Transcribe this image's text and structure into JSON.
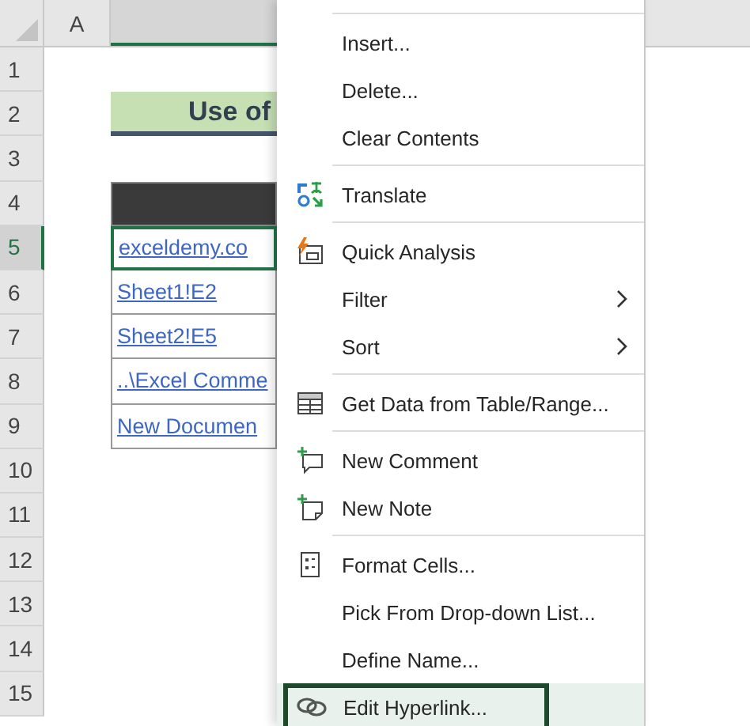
{
  "sheet": {
    "columns": [
      {
        "label": "A",
        "selected": false
      },
      {
        "selected": true
      }
    ],
    "rows": [
      {
        "number": "1",
        "selected": false,
        "kind": "blank"
      },
      {
        "number": "2",
        "selected": false,
        "kind": "title",
        "text": "Use of"
      },
      {
        "number": "3",
        "selected": false,
        "kind": "blank"
      },
      {
        "number": "4",
        "selected": false,
        "kind": "table_header"
      },
      {
        "number": "5",
        "selected": true,
        "kind": "link",
        "text": "exceldemy.co"
      },
      {
        "number": "6",
        "selected": false,
        "kind": "link",
        "text": "Sheet1!E2"
      },
      {
        "number": "7",
        "selected": false,
        "kind": "link",
        "text": "Sheet2!E5"
      },
      {
        "number": "8",
        "selected": false,
        "kind": "link",
        "text": "..\\Excel Comme"
      },
      {
        "number": "9",
        "selected": false,
        "kind": "link",
        "text": "New Documen"
      },
      {
        "number": "10",
        "selected": false,
        "kind": "blank"
      },
      {
        "number": "11",
        "selected": false,
        "kind": "blank"
      },
      {
        "number": "12",
        "selected": false,
        "kind": "blank"
      },
      {
        "number": "13",
        "selected": false,
        "kind": "blank"
      },
      {
        "number": "14",
        "selected": false,
        "kind": "blank"
      },
      {
        "number": "15",
        "selected": false,
        "kind": "blank"
      }
    ]
  },
  "context_menu": {
    "items": [
      {
        "kind": "separator"
      },
      {
        "kind": "item",
        "label": "Insert...",
        "submenu": false,
        "selected": false
      },
      {
        "kind": "item",
        "label": "Delete...",
        "submenu": false,
        "selected": false
      },
      {
        "kind": "item",
        "label": "Clear Contents",
        "submenu": false,
        "selected": false
      },
      {
        "kind": "separator"
      },
      {
        "kind": "translate",
        "label": "Translate",
        "submenu": false,
        "selected": false
      },
      {
        "kind": "separator"
      },
      {
        "kind": "analysis",
        "label": "Quick Analysis",
        "submenu": false,
        "selected": false
      },
      {
        "kind": "item",
        "label": "Filter",
        "submenu": true,
        "selected": false
      },
      {
        "kind": "item",
        "label": "Sort",
        "submenu": true,
        "selected": false
      },
      {
        "kind": "separator"
      },
      {
        "kind": "table",
        "label": "Get Data from Table/Range...",
        "submenu": false,
        "selected": false
      },
      {
        "kind": "separator"
      },
      {
        "kind": "comment",
        "label": "New Comment",
        "submenu": false,
        "selected": false
      },
      {
        "kind": "note",
        "label": "New Note",
        "submenu": false,
        "selected": false
      },
      {
        "kind": "separator"
      },
      {
        "kind": "format",
        "label": "Format Cells...",
        "submenu": false,
        "selected": false
      },
      {
        "kind": "item",
        "label": "Pick From Drop-down List...",
        "submenu": false,
        "selected": false
      },
      {
        "kind": "item",
        "label": "Define Name...",
        "submenu": false,
        "selected": false
      },
      {
        "kind": "link",
        "label": "Edit Hyperlink...",
        "submenu": false,
        "selected": true
      }
    ]
  }
}
